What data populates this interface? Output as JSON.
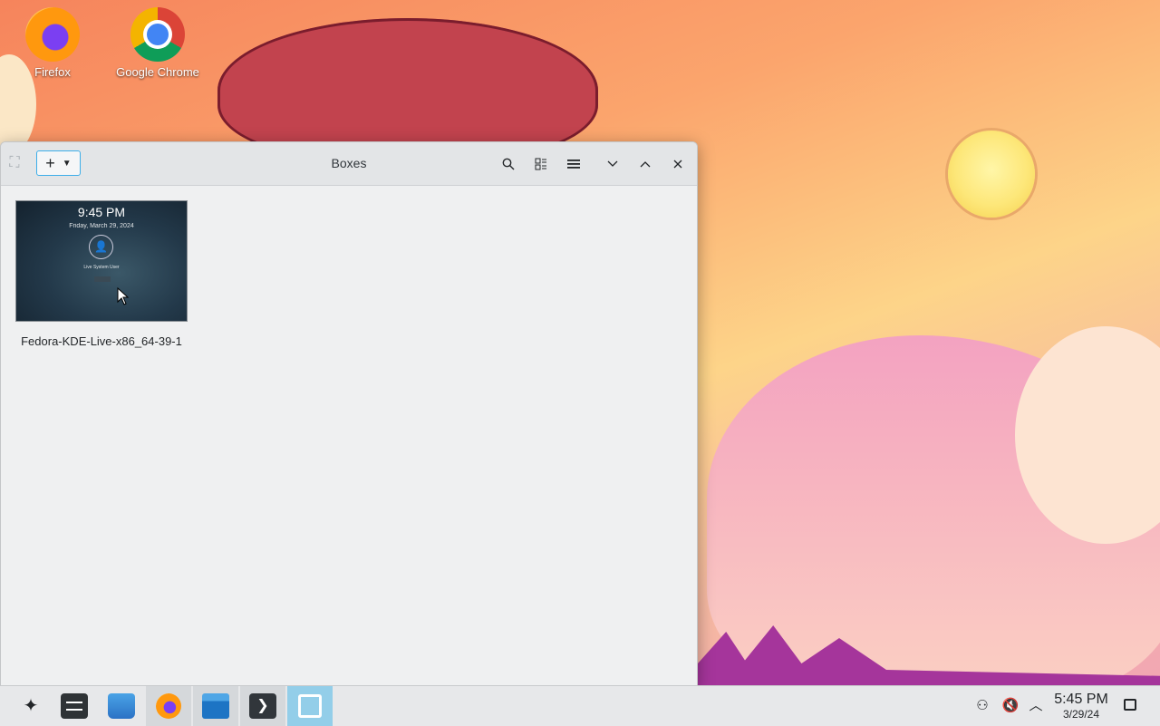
{
  "desktop": {
    "icons": [
      {
        "label": "Firefox",
        "icon": "firefox-icon"
      },
      {
        "label": "Google Chrome",
        "icon": "chrome-icon"
      }
    ]
  },
  "window": {
    "title": "Boxes",
    "new_button_icon": "+",
    "titlebar_buttons": [
      "search-icon",
      "view-toggle-icon",
      "menu-icon",
      "minimize-icon",
      "maximize-icon",
      "close-icon"
    ],
    "vm": {
      "name": "Fedora-KDE-Live-x86_64-39-1",
      "preview": {
        "time": "9:45 PM",
        "date": "Friday, March 29, 2024",
        "user": "Live System User"
      }
    }
  },
  "taskbar": {
    "apps": [
      "application-launcher-icon",
      "system-settings-icon",
      "discover-icon",
      "firefox-icon",
      "files-icon",
      "terminal-icon",
      "boxes-icon"
    ],
    "tray": [
      "network-icon",
      "volume-muted-icon",
      "tray-expand-icon"
    ],
    "clock": {
      "time": "5:45 PM",
      "date": "3/29/24"
    }
  },
  "colors": {
    "accent": "#3daee9",
    "focus": "#93cee9"
  }
}
